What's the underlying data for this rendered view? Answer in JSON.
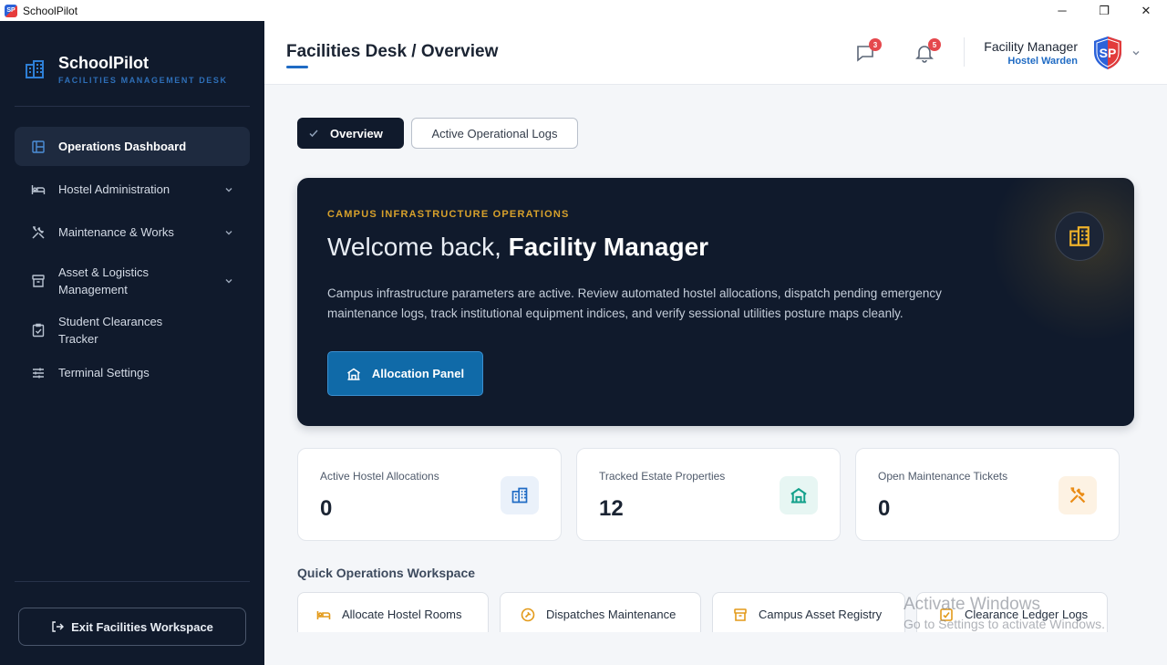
{
  "window": {
    "title": "SchoolPilot",
    "logo_text": "SP",
    "controls": {
      "minimize": "─",
      "maximize": "❐",
      "close": "✕"
    }
  },
  "brand": {
    "name": "SchoolPilot",
    "subtitle": "FACILITIES MANAGEMENT DESK",
    "icon": "building-icon"
  },
  "nav": {
    "items": [
      {
        "label": "Operations Dashboard",
        "icon": "dashboard-icon",
        "active": true,
        "expandable": false
      },
      {
        "label": "Hostel Administration",
        "icon": "bed-icon",
        "active": false,
        "expandable": true
      },
      {
        "label": "Maintenance & Works",
        "icon": "tools-icon",
        "active": false,
        "expandable": true
      },
      {
        "label": "Asset & Logistics Management",
        "icon": "archive-icon",
        "active": false,
        "expandable": true
      },
      {
        "label": "Student Clearances Tracker",
        "icon": "clipboard-check-icon",
        "active": false,
        "expandable": false
      },
      {
        "label": "Terminal Settings",
        "icon": "sliders-icon",
        "active": false,
        "expandable": false
      }
    ],
    "exit_label": "Exit Facilities Workspace"
  },
  "header": {
    "title": "Facilities Desk / Overview",
    "messages_count": "3",
    "notifications_count": "5",
    "user_name": "Facility Manager",
    "user_role": "Hostel Warden",
    "avatar_text": "SP"
  },
  "tabs": [
    {
      "label": "Overview",
      "active": true
    },
    {
      "label": "Active Operational Logs",
      "active": false
    }
  ],
  "hero": {
    "kicker": "CAMPUS INFRASTRUCTURE OPERATIONS",
    "greeting": "Welcome back, ",
    "name": "Facility Manager",
    "description": "Campus infrastructure parameters are active. Review automated hostel allocations, dispatch pending emergency maintenance logs, track institutional equipment indices, and verify sessional utilities posture maps cleanly.",
    "button_label": "Allocation Panel"
  },
  "stats": [
    {
      "label": "Active Hostel Allocations",
      "value": "0",
      "icon": "building-icon",
      "color": "#1f6bc4",
      "bg": "#eaf1fa"
    },
    {
      "label": "Tracked Estate Properties",
      "value": "12",
      "icon": "estate-icon",
      "color": "#12a08a",
      "bg": "#e7f6f3"
    },
    {
      "label": "Open Maintenance Tickets",
      "value": "0",
      "icon": "tools-icon",
      "color": "#ea8c16",
      "bg": "#fdf2e3"
    }
  ],
  "quick": {
    "title": "Quick Operations Workspace",
    "actions": [
      {
        "label": "Allocate Hostel Rooms",
        "icon": "bed-icon"
      },
      {
        "label": "Dispatches Maintenance",
        "icon": "wrench-icon"
      },
      {
        "label": "Campus Asset Registry",
        "icon": "archive-icon"
      },
      {
        "label": "Clearance Ledger Logs",
        "icon": "checkbox-icon"
      }
    ]
  },
  "watermark": {
    "line1": "Activate Windows",
    "line2": "Go to Settings to activate Windows."
  },
  "colors": {
    "sidebar": "#101a2c",
    "accent": "#1f6bc4",
    "gold": "#d7a12b",
    "badge": "#e5484d"
  }
}
